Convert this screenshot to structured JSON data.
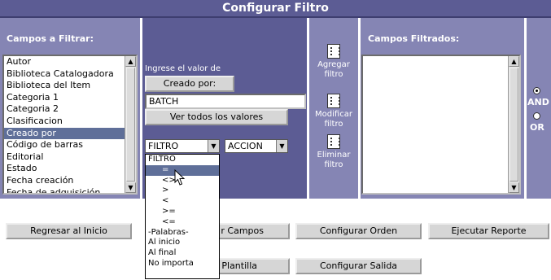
{
  "window": {
    "title": "Configurar Filtro"
  },
  "left_panel": {
    "label": "Campos a Filtrar:",
    "fields": [
      "Autor",
      "Biblioteca Catalogadora",
      "Biblioteca del Item",
      "Categoria 1",
      "Categoria 2",
      "Clasificacion",
      "Creado por",
      "Código de barras",
      "Editorial",
      "Estado",
      "Fecha creación",
      "Fecha de adquisición"
    ],
    "selected_index": 6
  },
  "middle_panel": {
    "hint": "Ingrese el valor de",
    "field_button": "Creado por:",
    "value_input": "BATCH",
    "all_values_button": "Ver todos los valores",
    "filter_select": {
      "value": "FILTRO"
    },
    "action_select": {
      "value": "ACCION"
    },
    "filter_options": [
      "FILTRO",
      "=",
      "<>",
      ">",
      "<",
      ">=",
      "<=",
      "-Palabras-",
      "Al inicio",
      "Al final",
      "No importa"
    ],
    "filter_highlighted_index": 1
  },
  "action_buttons": {
    "add": "Agregar filtro",
    "modify": "Modificar filtro",
    "delete": "Eliminar filtro"
  },
  "right_panel": {
    "label": "Campos Filtrados:"
  },
  "logic": {
    "and_label": "AND",
    "or_label": "OR",
    "selected": "AND"
  },
  "bottom_buttons": {
    "back": "Regresar al Inicio",
    "fields": "r Campos",
    "order": "Configurar Orden",
    "run": "Ejecutar Reporte",
    "template": "Plantilla",
    "output": "Configurar Salida"
  }
}
